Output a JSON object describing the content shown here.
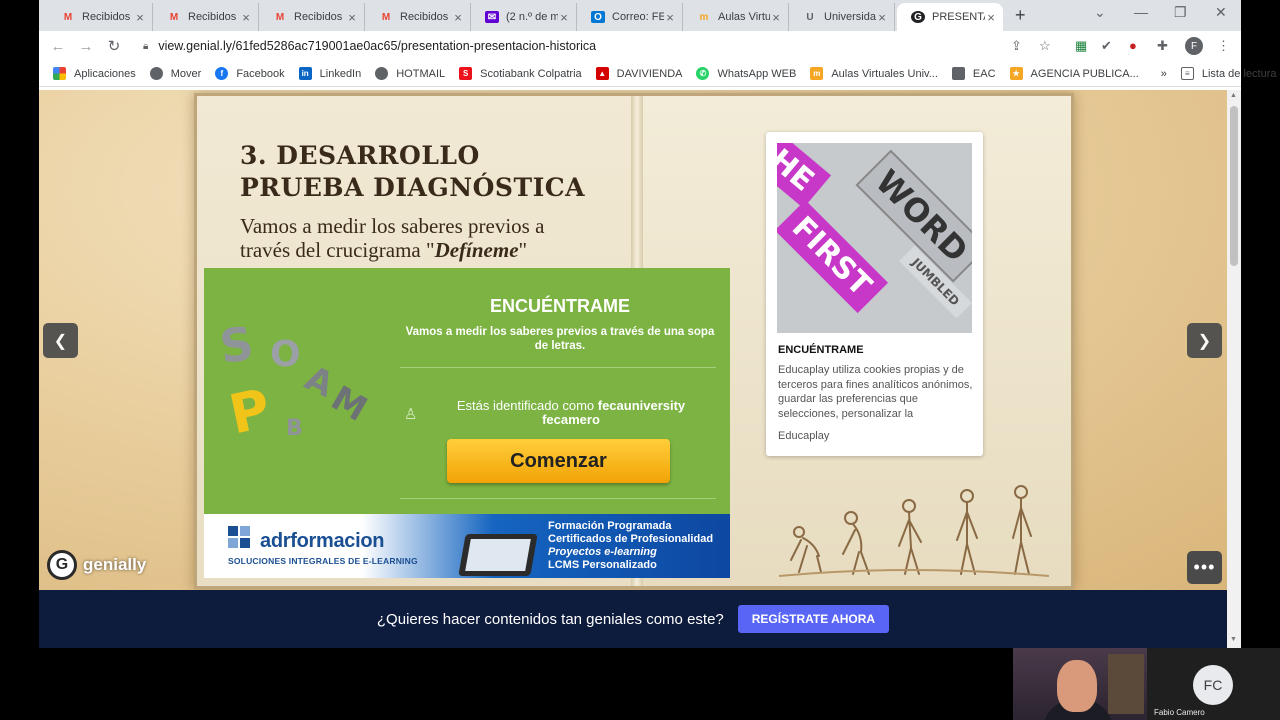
{
  "browser": {
    "tabs": [
      {
        "title": "Recibidos",
        "icon": "gmail-icon"
      },
      {
        "title": "Recibidos",
        "icon": "gmail-icon"
      },
      {
        "title": "Recibidos",
        "icon": "gmail-icon"
      },
      {
        "title": "Recibidos",
        "icon": "gmail-icon"
      },
      {
        "title": "(2 n.º de m",
        "icon": "yahoo-mail-icon"
      },
      {
        "title": "Correo: FE",
        "icon": "outlook-icon"
      },
      {
        "title": "Aulas Virtu",
        "icon": "moodle-icon"
      },
      {
        "title": "Universida",
        "icon": "university-icon"
      },
      {
        "title": "PRESENTA",
        "icon": "genially-icon"
      }
    ],
    "url": "view.genial.ly/61fed5286ac719001ae0ac65/presentation-presentacion-historica",
    "profile_initial": "F",
    "bookmarks": [
      {
        "label": "Aplicaciones",
        "color": "#ea4335"
      },
      {
        "label": "Mover",
        "color": "#5f6368"
      },
      {
        "label": "Facebook",
        "color": "#1877f2"
      },
      {
        "label": "LinkedIn",
        "color": "#0a66c2"
      },
      {
        "label": "HOTMAIL",
        "color": "#5f6368"
      },
      {
        "label": "Scotiabank Colpatria",
        "color": "#ec111a"
      },
      {
        "label": "DAVIVIENDA",
        "color": "#d50000"
      },
      {
        "label": "WhatsApp WEB",
        "color": "#25d366"
      },
      {
        "label": "Aulas Virtuales Univ...",
        "color": "#f5a623"
      },
      {
        "label": "EAC",
        "color": "#5f6368"
      },
      {
        "label": "AGENCIA PUBLICA...",
        "color": "#f5a623"
      }
    ],
    "bookmarks_overflow": "»",
    "reading_list": "Lista de lectura"
  },
  "slide": {
    "title_line1": "3. DESARROLLO",
    "title_line2": "PRUEBA DIAGNÓSTICA",
    "subtitle_line1": "Vamos a medir los saberes previos a",
    "subtitle_line2_prefix": "través del crucigrama \"",
    "subtitle_emphasis": "Defíneme",
    "subtitle_line2_suffix": "\""
  },
  "educaplay": {
    "title": "ENCUÉNTRAME",
    "description": "Vamos a medir los saberes previos a través de una sopa de letras.",
    "identified_prefix": "Estás identificado como ",
    "username": "fecauniversity",
    "username2": "fecamero",
    "start_button": "Comenzar",
    "letters": [
      "S",
      "O",
      "P",
      "A",
      "M",
      "B"
    ]
  },
  "ad": {
    "brand": "adrformacion",
    "tagline": "SOLUCIONES INTEGRALES DE E-LEARNING",
    "lines": [
      "Formación Programada",
      "Certificados de Profesionalidad",
      "Proyectos e-learning",
      "LCMS Personalizado"
    ]
  },
  "card": {
    "image_words": [
      "HE",
      "WORD",
      "FIRST",
      "JUMBLED"
    ],
    "title": "ENCUÉNTRAME",
    "description": "Educaplay utiliza cookies propias y de terceros para fines analíticos anónimos, guardar las preferencias que selecciones, personalizar la publicidad...",
    "source": "Educaplay"
  },
  "genially": {
    "logo_text": "genially",
    "logo_letter": "G",
    "cta_text": "¿Quieres hacer contenidos tan geniales como este?",
    "cta_button": "REGÍSTRATE AHORA"
  },
  "call": {
    "participant_initials": "FC",
    "participant_name": "Fabio Camero"
  }
}
